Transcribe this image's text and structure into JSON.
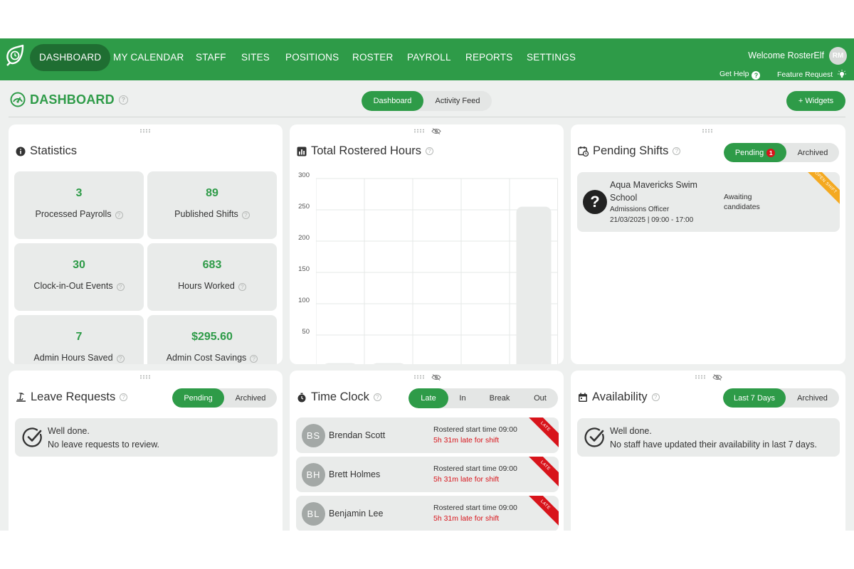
{
  "nav": {
    "items": [
      {
        "label": "DASHBOARD",
        "active": true
      },
      {
        "label": "MY CALENDAR"
      },
      {
        "label": "STAFF"
      },
      {
        "label": "SITES"
      },
      {
        "label": "POSITIONS"
      },
      {
        "label": "ROSTER"
      },
      {
        "label": "PAYROLL"
      },
      {
        "label": "REPORTS"
      },
      {
        "label": "SETTINGS"
      }
    ],
    "welcome": "Welcome RosterElf",
    "avatar_initials": "RM",
    "get_help": "Get Help",
    "feature_request": "Feature Request",
    "brand_color": "#2e9b48"
  },
  "page": {
    "title": "DASHBOARD",
    "tabs": [
      "Dashboard",
      "Activity Feed"
    ],
    "active_tab": "Dashboard",
    "widgets_button": "+ Widgets"
  },
  "statistics": {
    "title": "Statistics",
    "items": [
      {
        "value": "3",
        "label": "Processed Payrolls"
      },
      {
        "value": "89",
        "label": "Published Shifts"
      },
      {
        "value": "30",
        "label": "Clock-in-Out Events"
      },
      {
        "value": "683",
        "label": "Hours Worked"
      },
      {
        "value": "7",
        "label": "Admin Hours Saved"
      },
      {
        "value": "$295.60",
        "label": "Admin Cost Savings"
      }
    ]
  },
  "hours": {
    "title": "Total Rostered Hours",
    "y_ticks": [
      "300",
      "250",
      "200",
      "150",
      "100",
      "50"
    ]
  },
  "chart_data": {
    "type": "bar",
    "title": "Total Rostered Hours",
    "ylim": [
      0,
      300
    ],
    "values": [
      5,
      5,
      3,
      0,
      255
    ],
    "grid": true
  },
  "pending_shifts": {
    "title": "Pending Shifts",
    "tabs": [
      "Pending",
      "Archived"
    ],
    "active_tab": "Pending",
    "count_badge": "1",
    "item": {
      "site_line1": "Aqua Mavericks Swim",
      "site_line2": "School",
      "position": "Admissions Officer",
      "datetime": "21/03/2025 | 09:00 - 17:00",
      "status_line1": "Awaiting",
      "status_line2": "candidates",
      "ribbon": "OPEN SHIFT"
    }
  },
  "leave": {
    "title": "Leave Requests",
    "tabs": [
      "Pending",
      "Archived"
    ],
    "active_tab": "Pending",
    "msg1": "Well done.",
    "msg2": "No leave requests to review."
  },
  "timeclock": {
    "title": "Time Clock",
    "tabs": [
      "Late",
      "In",
      "Break",
      "Out"
    ],
    "active_tab": "Late",
    "rows": [
      {
        "initials": "BS",
        "name": "Brendan Scott",
        "rostered": "Rostered start time 09:00",
        "late": "5h 31m late for shift",
        "ribbon": "LATE"
      },
      {
        "initials": "BH",
        "name": "Brett Holmes",
        "rostered": "Rostered start time 09:00",
        "late": "5h 31m late for shift",
        "ribbon": "LATE"
      },
      {
        "initials": "BL",
        "name": "Benjamin Lee",
        "rostered": "Rostered start time 09:00",
        "late": "5h 31m late for shift",
        "ribbon": "LATE"
      }
    ]
  },
  "availability": {
    "title": "Availability",
    "tabs": [
      "Last 7 Days",
      "Archived"
    ],
    "active_tab": "Last 7 Days",
    "msg1": "Well done.",
    "msg2": "No staff have updated their availability in last 7 days."
  }
}
